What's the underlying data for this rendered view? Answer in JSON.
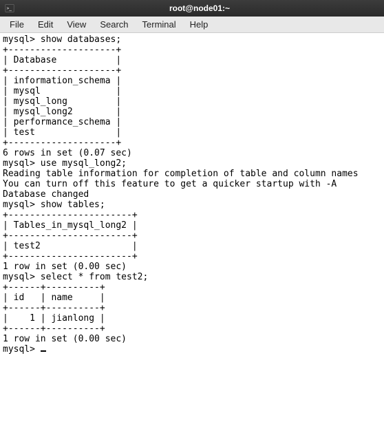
{
  "window": {
    "title": "root@node01:~"
  },
  "menu": {
    "file": "File",
    "edit": "Edit",
    "view": "View",
    "search": "Search",
    "terminal": "Terminal",
    "help": "Help"
  },
  "terminal": {
    "lines": [
      "mysql> show databases;",
      "+--------------------+",
      "| Database           |",
      "+--------------------+",
      "| information_schema |",
      "| mysql              |",
      "| mysql_long         |",
      "| mysql_long2        |",
      "| performance_schema |",
      "| test               |",
      "+--------------------+",
      "6 rows in set (0.07 sec)",
      "",
      "mysql> use mysql_long2;",
      "Reading table information for completion of table and column names",
      "You can turn off this feature to get a quicker startup with -A",
      "",
      "Database changed",
      "mysql> show tables;",
      "+-----------------------+",
      "| Tables_in_mysql_long2 |",
      "+-----------------------+",
      "| test2                 |",
      "+-----------------------+",
      "1 row in set (0.00 sec)",
      "",
      "mysql> select * from test2;",
      "+------+----------+",
      "| id   | name     |",
      "+------+----------+",
      "|    1 | jianlong |",
      "+------+----------+",
      "1 row in set (0.00 sec)",
      "",
      "mysql> "
    ],
    "prompt_with_cursor": true
  }
}
